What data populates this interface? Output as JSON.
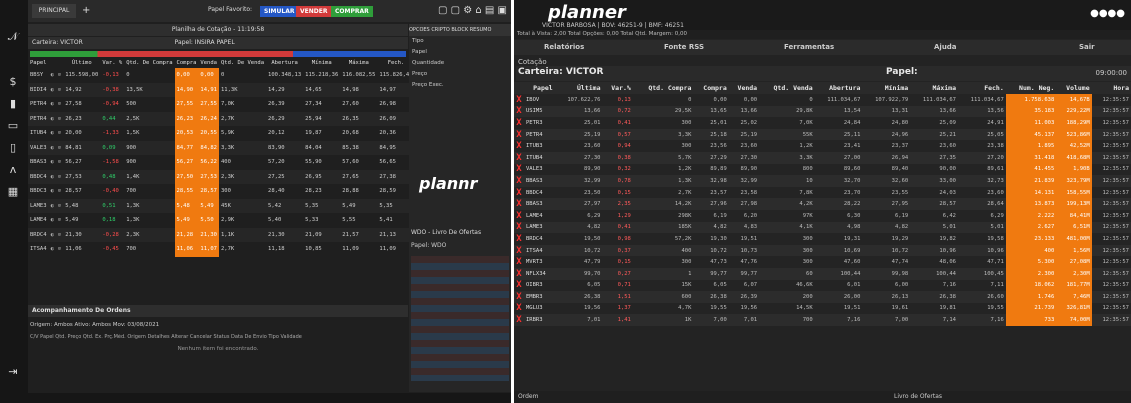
{
  "left": {
    "tab_label": "PRINCIPAL",
    "plus": "+",
    "papel_favorito": "Papel Favorito:",
    "btn1": "SIMULAR",
    "btn2": "VENDER",
    "btn3": "COMPRAR",
    "btn_colors": [
      "#2457c5",
      "#d23a3a",
      "#2f9e3a"
    ],
    "window_title": "Planilha de Cotação - 11:19:58",
    "carteira_label": "Carteira: VICTOR",
    "papel_label": "Papel: INSIRA PAPEL",
    "columns": [
      "Papel",
      "",
      "",
      "Último",
      "Var. %",
      "Qtd. De Compra",
      "Compra",
      "Venda",
      "Qtd. De Venda",
      "Abertura",
      "Mínima",
      "Máxima",
      "Fech.",
      "Qtd. Ordens"
    ],
    "rows": [
      [
        "BBSY",
        "",
        "",
        "115.598,00",
        "-0,13",
        "0",
        "0,00",
        "0,00",
        "0",
        "100.348,13",
        "115.218,36",
        "116.082,55",
        "115.826,41",
        "0"
      ],
      [
        "BIDI4",
        "",
        "",
        "14,92",
        "-0,38",
        "13,5K",
        "14,90",
        "14,91",
        "11,3K",
        "14,29",
        "14,65",
        "14,98",
        "14,97",
        "300"
      ],
      [
        "PETR4",
        "",
        "",
        "27,58",
        "-0,94",
        "500",
        "27,55",
        "27,55",
        "7,0K",
        "26,39",
        "27,34",
        "27,60",
        "26,98",
        "300"
      ],
      [
        "PETR4",
        "",
        "",
        "26,23",
        "0,44",
        "2,5K",
        "26,23",
        "26,24",
        "2,7K",
        "26,29",
        "25,94",
        "26,35",
        "26,09",
        "300"
      ],
      [
        "ITUB4",
        "",
        "",
        "20,00",
        "-1,33",
        "1,5K",
        "20,53",
        "20,55",
        "5,9K",
        "20,12",
        "19,87",
        "20,68",
        "20,36",
        "300"
      ],
      [
        "VALE3",
        "",
        "",
        "84,81",
        "0,09",
        "900",
        "84,77",
        "84,82",
        "3,3K",
        "83,90",
        "84,04",
        "85,38",
        "84,95",
        "300"
      ],
      [
        "BBAS3",
        "",
        "",
        "56,27",
        "-1,58",
        "900",
        "56,27",
        "56,22",
        "400",
        "57,20",
        "55,90",
        "57,60",
        "56,65",
        "300"
      ],
      [
        "BBDC4",
        "",
        "",
        "27,53",
        "0,48",
        "1,4K",
        "27,50",
        "27,53",
        "2,3K",
        "27,25",
        "26,95",
        "27,65",
        "27,38",
        "300"
      ],
      [
        "BBDC3",
        "",
        "",
        "28,57",
        "-0,40",
        "700",
        "28,55",
        "28,57",
        "300",
        "28,40",
        "28,23",
        "28,88",
        "28,59",
        "300"
      ],
      [
        "LAME3",
        "",
        "",
        "5,48",
        "0,51",
        "1,3K",
        "5,48",
        "5,49",
        "45K",
        "5,42",
        "5,35",
        "5,49",
        "5,35",
        "300"
      ],
      [
        "LAME4",
        "",
        "",
        "5,49",
        "0,18",
        "1,3K",
        "5,49",
        "5,50",
        "2,9K",
        "5,40",
        "5,33",
        "5,55",
        "5,41",
        "300"
      ],
      [
        "BRDC4",
        "",
        "",
        "21,30",
        "-0,28",
        "2,3K",
        "21,28",
        "21,30",
        "1,1K",
        "21,30",
        "21,09",
        "21,57",
        "21,13",
        "300"
      ],
      [
        "ITSA4",
        "",
        "",
        "11,06",
        "-0,45",
        "700",
        "11,06",
        "11,07",
        "2,7K",
        "11,18",
        "10,85",
        "11,09",
        "11,09",
        "300"
      ]
    ],
    "orange_cols": [
      6,
      7
    ],
    "orders_title": "Acompanhamento De Ordens",
    "orders_filter": "Origem: Ambos  Ativo: Ambos  Mov: 03/08/2021",
    "orders_cols": "C/V  Papel  Qtd.  Preço  Qtd. Ex.  Prç.Méd.  Origem  Detalhes  Alterar  Cancelar  Status  Data De Envio  Tipo  Validade",
    "orders_empty": "Nenhum item foi encontrado.",
    "side_tabs": [
      "OPCOES",
      "CRIPTO",
      "BLOCK",
      "RESUMO"
    ],
    "side_labels": [
      "Tipo",
      "Papel",
      "Quantidade",
      "Preço",
      "Preço Exec."
    ],
    "side_brand": "plannr",
    "book_title": "WDO - Livro De Ofertas",
    "book_papel": "Papel: WDO"
  },
  "right": {
    "logo": "planner",
    "user_info": "VICTOR BARBOSA | BOV: 46251-9 | BMF: 46251",
    "status_text": "Total à Vista: 2,00    Total Opções: 0,00    Total Qtd. Margem: 0,00",
    "menu": [
      "Relatórios",
      "Fonte RSS",
      "Ferramentas",
      "Ajuda",
      "Sair"
    ],
    "section": "Cotação",
    "carteira": "Carteira: VICTOR",
    "papel": "Papel:",
    "clock": "09:00:00",
    "columns": [
      "",
      "Papel",
      "Última",
      "Var.%",
      "Qtd. Compra",
      "Compra",
      "Venda",
      "Qtd. Venda",
      "Abertura",
      "Mínima",
      "Máxima",
      "Fech.",
      "Num. Neg.",
      "Volume",
      "Hora"
    ],
    "rows": [
      [
        "X",
        "IBOV",
        "107.622,76",
        "0,13",
        "0",
        "0,00",
        "0,00",
        "0",
        "111.034,67",
        "107.922,79",
        "111.034,67",
        "111.034,67",
        "1.758.638",
        "14,67B",
        "12:35:57"
      ],
      [
        "X",
        "USIM5",
        "13,66",
        "0,72",
        "29,5K",
        "13,65",
        "13,66",
        "29,8K",
        "13,54",
        "13,31",
        "13,66",
        "13,56",
        "35.183",
        "229,22M",
        "12:35:57"
      ],
      [
        "X",
        "PETR3",
        "25,01",
        "0,41",
        "300",
        "25,01",
        "25,02",
        "7,0K",
        "24,84",
        "24,80",
        "25,09",
        "24,91",
        "11.003",
        "188,29M",
        "12:35:57"
      ],
      [
        "X",
        "PETR4",
        "25,19",
        "0,57",
        "3,3K",
        "25,18",
        "25,19",
        "55K",
        "25,11",
        "24,96",
        "25,21",
        "25,05",
        "45.137",
        "523,86M",
        "12:35:57"
      ],
      [
        "X",
        "ITUB3",
        "23,60",
        "0,94",
        "300",
        "23,56",
        "23,60",
        "1,2K",
        "23,41",
        "23,37",
        "23,60",
        "23,38",
        "1.895",
        "42,52M",
        "12:35:57"
      ],
      [
        "X",
        "ITUB4",
        "27,30",
        "0,38",
        "5,7K",
        "27,29",
        "27,30",
        "3,3K",
        "27,00",
        "26,94",
        "27,35",
        "27,20",
        "31.418",
        "418,68M",
        "12:35:57"
      ],
      [
        "X",
        "VALE3",
        "89,90",
        "0,32",
        "1,2K",
        "89,89",
        "89,90",
        "800",
        "89,60",
        "89,40",
        "90,00",
        "89,61",
        "41.455",
        "1,90B",
        "12:35:57"
      ],
      [
        "X",
        "BBAS3",
        "32,99",
        "0,78",
        "1,3K",
        "32,98",
        "32,99",
        "10",
        "32,70",
        "32,60",
        "33,00",
        "32,73",
        "21.839",
        "323,79M",
        "12:35:57"
      ],
      [
        "X",
        "BBDC4",
        "23,50",
        "0,15",
        "2,7K",
        "23,57",
        "23,58",
        "7,8K",
        "23,70",
        "23,55",
        "24,03",
        "23,60",
        "14.131",
        "158,55M",
        "12:35:57"
      ],
      [
        "X",
        "BBAS3",
        "27,97",
        "2,35",
        "14,2K",
        "27,96",
        "27,98",
        "4,2K",
        "28,22",
        "27,95",
        "28,57",
        "28,64",
        "13.873",
        "199,13M",
        "12:35:57"
      ],
      [
        "X",
        "LAME4",
        "6,29",
        "1,29",
        "298K",
        "6,19",
        "6,20",
        "97K",
        "6,30",
        "6,19",
        "6,42",
        "6,29",
        "2.222",
        "84,41M",
        "12:35:57"
      ],
      [
        "X",
        "LAME3",
        "4,82",
        "0,41",
        "185K",
        "4,82",
        "4,83",
        "4,1K",
        "4,98",
        "4,82",
        "5,01",
        "5,01",
        "2.627",
        "6,51M",
        "12:35:57"
      ],
      [
        "X",
        "BRDC4",
        "19,50",
        "0,98",
        "57,2K",
        "19,30",
        "19,51",
        "300",
        "19,31",
        "19,29",
        "19,82",
        "19,58",
        "23.133",
        "481,00M",
        "12:35:57"
      ],
      [
        "X",
        "ITSA4",
        "10,72",
        "0,37",
        "400",
        "10,72",
        "10,73",
        "300",
        "10,69",
        "10,72",
        "10,96",
        "10,96",
        "400",
        "1,56M",
        "12:35:57"
      ],
      [
        "X",
        "MVRT3",
        "47,79",
        "0,15",
        "300",
        "47,73",
        "47,76",
        "300",
        "47,60",
        "47,74",
        "48,06",
        "47,71",
        "5.300",
        "27,08M",
        "12:35:57"
      ],
      [
        "X",
        "NFLX34",
        "99,70",
        "0,27",
        "1",
        "99,77",
        "99,77",
        "60",
        "100,44",
        "99,98",
        "100,44",
        "100,45",
        "2.300",
        "2,30M",
        "12:35:57"
      ],
      [
        "X",
        "OIBR3",
        "6,05",
        "0,71",
        "15K",
        "6,05",
        "6,07",
        "46,6K",
        "6,01",
        "6,00",
        "7,16",
        "7,11",
        "18.062",
        "181,77M",
        "12:35:57"
      ],
      [
        "X",
        "EMBR3",
        "26,38",
        "1,51",
        "600",
        "26,38",
        "26,39",
        "200",
        "26,00",
        "26,13",
        "26,38",
        "26,60",
        "1.746",
        "7,46M",
        "12:35:57"
      ],
      [
        "X",
        "MGLU3",
        "19,56",
        "1,37",
        "4,7K",
        "19,55",
        "19,56",
        "14,5K",
        "19,51",
        "19,61",
        "19,81",
        "19,55",
        "21.739",
        "326,81M",
        "12:35:57"
      ],
      [
        "X",
        "IRBR3",
        "7,01",
        "1,41",
        "1K",
        "7,00",
        "7,01",
        "700",
        "7,16",
        "7,00",
        "7,14",
        "7,16",
        "733",
        "74,00M",
        "12:35:57"
      ]
    ],
    "orange_cols": [
      12,
      13
    ],
    "footer_left": "Ordem",
    "footer_right": "Livro de Ofertas"
  }
}
